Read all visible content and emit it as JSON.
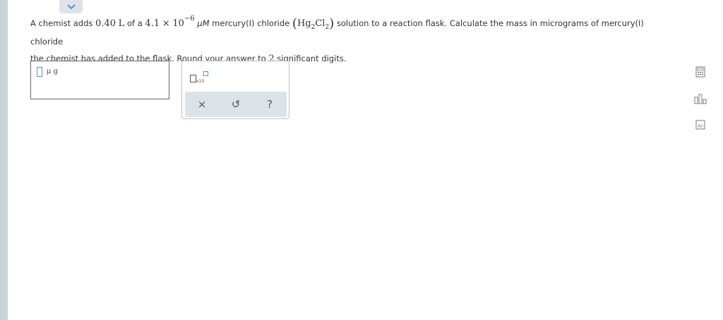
{
  "question": {
    "p1_pre": "A chemist adds ",
    "volume_value": "0.40",
    "volume_unit": "L",
    "p1_mid": " of a ",
    "conc_mantissa": "4.1",
    "times": "×",
    "ten": "10",
    "exponent": "−6",
    "conc_unit": "μM",
    "p1_compound": " mercury(I) chloride ",
    "formula_paren_open": "(",
    "formula_hg": "Hg",
    "formula_hg_sub": "2",
    "formula_cl": "Cl",
    "formula_cl_sub": "2",
    "formula_paren_close": ")",
    "p1_post": " solution to a reaction flask. Calculate the mass in micrograms of mercury(I) chloride",
    "p2_pre": "the chemist has added to the flask. Round your answer to ",
    "sig_figs": "2",
    "p2_post": " significant digits."
  },
  "answer": {
    "unit": "μ g",
    "value": ""
  },
  "palette": {
    "sci_label": "x10",
    "clear_symbol": "×",
    "undo_symbol": "↺",
    "help_symbol": "?"
  },
  "icons": {
    "collapse": "chevron-down-icon",
    "calculator": "calculator-icon",
    "chart": "bar-chart-icon",
    "periodic_table": "periodic-table-icon"
  },
  "side_tools": {
    "periodic_symbol": "Ar"
  },
  "colors": {
    "accent": "#5a8fd6",
    "left_bar": "#c9d4d9",
    "action_bar": "#dce3e8"
  }
}
